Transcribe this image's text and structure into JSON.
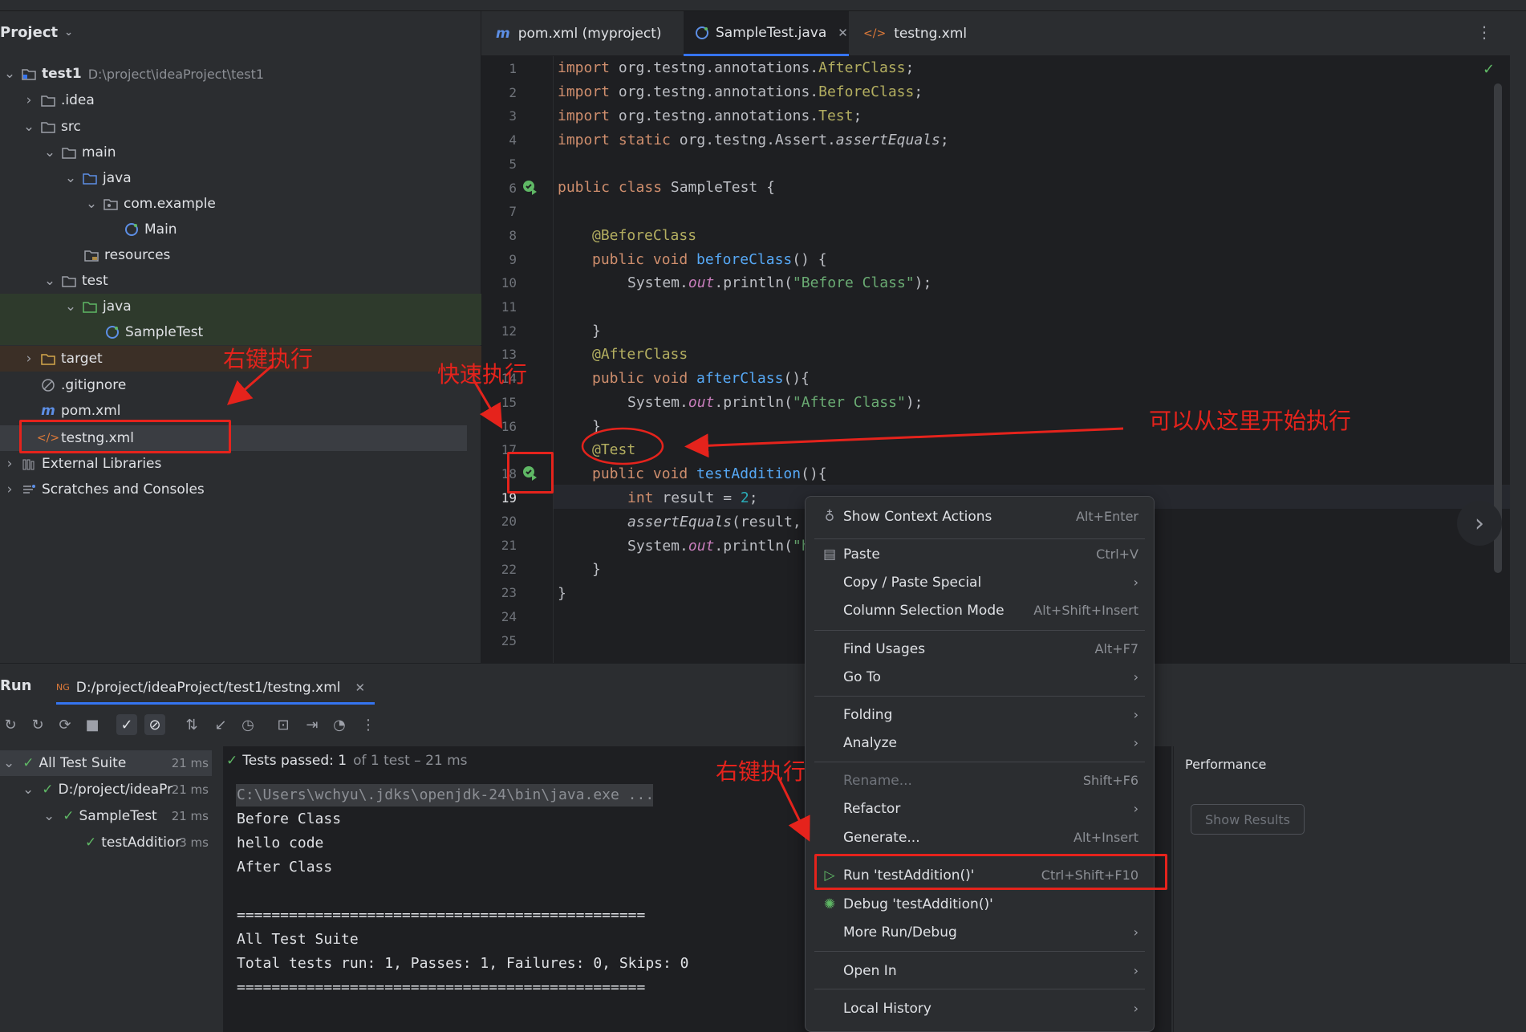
{
  "project": {
    "title": "Project",
    "tree": [
      {
        "label": "test1",
        "path": "D:\\project\\ideaProject\\test1"
      },
      {
        "label": ".idea"
      },
      {
        "label": "src"
      },
      {
        "label": "main"
      },
      {
        "label": "java"
      },
      {
        "label": "com.example"
      },
      {
        "label": "Main"
      },
      {
        "label": "resources"
      },
      {
        "label": "test"
      },
      {
        "label": "java"
      },
      {
        "label": "SampleTest"
      },
      {
        "label": "target"
      },
      {
        "label": ".gitignore"
      },
      {
        "label": "pom.xml"
      },
      {
        "label": "testng.xml"
      },
      {
        "label": "External Libraries"
      },
      {
        "label": "Scratches and Consoles"
      }
    ]
  },
  "editor": {
    "tabs": [
      {
        "label": "pom.xml (myproject)"
      },
      {
        "label": "SampleTest.java"
      },
      {
        "label": "testng.xml"
      }
    ],
    "line_numbers": [
      "1",
      "2",
      "3",
      "4",
      "5",
      "6",
      "7",
      "8",
      "9",
      "10",
      "11",
      "12",
      "13",
      "14",
      "15",
      "16",
      "17",
      "18",
      "19",
      "20",
      "21",
      "22",
      "23",
      "24",
      "25"
    ]
  },
  "code": {
    "l1_kw": "import",
    "l1_rest": " org.testng.annotations.",
    "l1_id": "AfterClass",
    "l1_end": ";",
    "l2_kw": "import",
    "l2_rest": " org.testng.annotations.",
    "l2_id": "BeforeClass",
    "l2_end": ";",
    "l3_kw": "import",
    "l3_rest": " org.testng.annotations.",
    "l3_id": "Test",
    "l3_end": ";",
    "l4_kw": "import static",
    "l4_rest": " org.testng.Assert.",
    "l4_id": "assertEquals",
    "l4_end": ";",
    "l6_kw": "public class",
    "l6_rest": " SampleTest {",
    "l8_ann": "@BeforeClass",
    "l9_kw": "public void",
    "l9_fn": " beforeClass",
    "l9_rest": "() {",
    "l10_a": "System.",
    "l10_f": "out",
    "l10_b": ".println(",
    "l10_s": "\"Before Class\"",
    "l10_c": ");",
    "l12": "}",
    "l13_ann": "@AfterClass",
    "l14_kw": "public void",
    "l14_fn": " afterClass",
    "l14_rest": "(){",
    "l15_a": "System.",
    "l15_f": "out",
    "l15_b": ".println(",
    "l15_s": "\"After Class\"",
    "l15_c": ");",
    "l16": "}",
    "l17_ann": "@Test",
    "l18_kw": "public void",
    "l18_fn": " testAddition",
    "l18_rest": "(){",
    "l19_kw": "int",
    "l19_rest": " result = ",
    "l19_num": "2",
    "l19_end": ";",
    "l20_it": "assertEquals",
    "l20_rest": "(result,",
    "l21_a": "System.",
    "l21_f": "out",
    "l21_b": ".println(",
    "l21_s": "\"h",
    "l22": "}",
    "l23": "}"
  },
  "run": {
    "title": "Run",
    "tab_label": "D:/project/ideaProject/test1/testng.xml",
    "status_bold": "Tests passed: 1",
    "status_rest": "of 1 test – 21 ms",
    "tree": [
      {
        "label": "All Test Suite",
        "time": "21 ms"
      },
      {
        "label": "D:/project/ideaPr",
        "time": "21 ms"
      },
      {
        "label": "SampleTest",
        "time": "21 ms"
      },
      {
        "label": "testAdditior",
        "time": "3 ms"
      }
    ],
    "console": [
      "C:\\Users\\wchyu\\.jdks\\openjdk-24\\bin\\java.exe ...",
      "Before Class",
      "hello code",
      "After Class",
      "===============================================",
      "All Test Suite",
      "Total tests run: 1, Passes: 1, Failures: 0, Skips: 0",
      "==============================================="
    ],
    "perf_title": "Performance",
    "perf_button": "Show Results"
  },
  "context_menu": [
    {
      "label": "Show Context Actions",
      "shortcut": "Alt+Enter",
      "icon": "bulb-icon"
    },
    {
      "label": "Paste",
      "shortcut": "Ctrl+V",
      "icon": "clipboard-icon"
    },
    {
      "label": "Copy / Paste Special",
      "arrow": "›"
    },
    {
      "label": "Column Selection Mode",
      "shortcut": "Alt+Shift+Insert"
    },
    {
      "label": "Find Usages",
      "shortcut": "Alt+F7"
    },
    {
      "label": "Go To",
      "arrow": "›"
    },
    {
      "label": "Folding",
      "arrow": "›"
    },
    {
      "label": "Analyze",
      "arrow": "›"
    },
    {
      "label": "Rename...",
      "shortcut": "Shift+F6"
    },
    {
      "label": "Refactor",
      "arrow": "›"
    },
    {
      "label": "Generate...",
      "shortcut": "Alt+Insert"
    },
    {
      "label": "Run 'testAddition()'",
      "shortcut": "Ctrl+Shift+F10",
      "icon": "run-icon"
    },
    {
      "label": "Debug 'testAddition()'",
      "icon": "debug-icon"
    },
    {
      "label": "More Run/Debug",
      "arrow": "›"
    },
    {
      "label": "Open In",
      "arrow": "›"
    },
    {
      "label": "Local History",
      "arrow": "›"
    }
  ],
  "annotations": {
    "right_click_1": "右键执行",
    "quick_run": "快速执行",
    "start_here": "可以从这里开始执行",
    "right_click_2": "右键执行"
  },
  "colors": {
    "accent": "#3574f0",
    "annotation_red": "#e5231c",
    "pass_green": "#5fb865"
  }
}
